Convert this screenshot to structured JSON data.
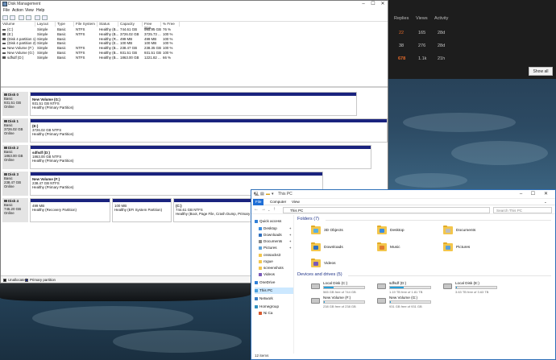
{
  "forum": {
    "headers": [
      "Replies",
      "Views",
      "Activity"
    ],
    "rows": [
      {
        "replies": "22",
        "views": "165",
        "activity": "28d",
        "accent": "#e56b2b"
      },
      {
        "replies": "38",
        "views": "276",
        "activity": "28d",
        "accent": "#c8c8c8"
      },
      {
        "replies": "678",
        "views": "1.1k",
        "activity": "21h",
        "accent": "#e56b2b"
      }
    ],
    "show_all": "Show all"
  },
  "disk_mgmt": {
    "title": "Disk Management",
    "menu": [
      "File",
      "Action",
      "View",
      "Help"
    ],
    "columns": [
      "Volume",
      "Layout",
      "Type",
      "File System",
      "Status",
      "Capacity",
      "Free Spa...",
      "% Free"
    ],
    "volumes": [
      {
        "volume": "(C:)",
        "layout": "Simple",
        "type": "Basic",
        "fs": "NTFS",
        "status": "Healthy (B...",
        "capacity": "744.61 GB",
        "free": "565.95 GB",
        "pct": "76 %"
      },
      {
        "volume": "(E:)",
        "layout": "Simple",
        "type": "Basic",
        "fs": "NTFS",
        "status": "Healthy (B...",
        "capacity": "3726.02 GB",
        "free": "3725.73 ...",
        "pct": "100 %"
      },
      {
        "volume": "(Disk 4 partition 1)",
        "layout": "Simple",
        "type": "Basic",
        "fs": "",
        "status": "Healthy (R...",
        "capacity": "499 MB",
        "free": "499 MB",
        "pct": "100 %"
      },
      {
        "volume": "(Disk 4 partition 2)",
        "layout": "Simple",
        "type": "Basic",
        "fs": "",
        "status": "Healthy (E...",
        "capacity": "100 MB",
        "free": "100 MB",
        "pct": "100 %"
      },
      {
        "volume": "New Volume (F:)",
        "layout": "Simple",
        "type": "Basic",
        "fs": "NTFS",
        "status": "Healthy (B...",
        "capacity": "238.47 GB",
        "free": "238.35 GB",
        "pct": "100 %"
      },
      {
        "volume": "New Volume (G:)",
        "layout": "Simple",
        "type": "Basic",
        "fs": "NTFS",
        "status": "Healthy (B...",
        "capacity": "931.51 GB",
        "free": "931.51 GB",
        "pct": "100 %"
      },
      {
        "volume": "sdfsdf (D:)",
        "layout": "Simple",
        "type": "Basic",
        "fs": "NTFS",
        "status": "Healthy (B...",
        "capacity": "1863.00 GB",
        "free": "1221.82 ...",
        "pct": "66 %"
      }
    ],
    "disks": [
      {
        "name": "Disk 0",
        "type": "Basic",
        "size": "931.51 GB",
        "state": "Online",
        "parts": [
          {
            "name": "New Volume (G:)",
            "size": "931.51 GB NTFS",
            "status": "Healthy (Primary Partition)"
          }
        ]
      },
      {
        "name": "Disk 1",
        "type": "Basic",
        "size": "3726.02 GB",
        "state": "Online",
        "parts": [
          {
            "name": "(E:)",
            "size": "3726.02 GB NTFS",
            "status": "Healthy (Primary Partition)"
          }
        ]
      },
      {
        "name": "Disk 2",
        "type": "Basic",
        "size": "1863.00 GB",
        "state": "Online",
        "parts": [
          {
            "name": "sdfsdf (D:)",
            "size": "1863.00 GB NTFS",
            "status": "Healthy (Primary Partition)"
          }
        ]
      },
      {
        "name": "Disk 3",
        "type": "Basic",
        "size": "238.47 GB",
        "state": "Online",
        "parts": [
          {
            "name": "New Volume (F:)",
            "size": "238.47 GB NTFS",
            "status": "Healthy (Primary Partition)"
          }
        ]
      },
      {
        "name": "Disk 4",
        "type": "Basic",
        "size": "745.20 GB",
        "state": "Online",
        "parts": [
          {
            "name": "",
            "size": "499 MB",
            "status": "Healthy (Recovery Partition)"
          },
          {
            "name": "",
            "size": "100 MB",
            "status": "Healthy (EFI System Partition)"
          },
          {
            "name": "(C:)",
            "size": "744.61 GB NTFS",
            "status": "Healthy (Boot, Page File, Crash Dump, Primary Partition)"
          }
        ]
      }
    ],
    "legend": [
      "Unallocated",
      "Primary partition"
    ],
    "colors": {
      "primary": "#1a237e",
      "unallocated": "#111111"
    }
  },
  "explorer": {
    "title": "This PC",
    "ribbon_tabs": [
      "File",
      "Computer",
      "View"
    ],
    "path": "This PC",
    "search_placeholder": "Search This PC",
    "nav": [
      {
        "label": "Quick access",
        "icon": "star-icon",
        "color": "#2f7fd8",
        "sub": false,
        "pin": false,
        "sel": false
      },
      {
        "label": "Desktop",
        "icon": "desktop-icon",
        "color": "#3a8de0",
        "sub": true,
        "pin": true,
        "sel": false
      },
      {
        "label": "Downloads",
        "icon": "download-icon",
        "color": "#2f6fbf",
        "sub": true,
        "pin": true,
        "sel": false
      },
      {
        "label": "Documents",
        "icon": "documents-icon",
        "color": "#8a8a8a",
        "sub": true,
        "pin": true,
        "sel": false
      },
      {
        "label": "Pictures",
        "icon": "pictures-icon",
        "color": "#5aa0d8",
        "sub": true,
        "pin": true,
        "sel": false
      },
      {
        "label": "csssacks3",
        "icon": "folder-icon",
        "color": "#f3c64c",
        "sub": true,
        "pin": false,
        "sel": false
      },
      {
        "label": "rogue",
        "icon": "folder-icon",
        "color": "#f3c64c",
        "sub": true,
        "pin": false,
        "sel": false
      },
      {
        "label": "screenshots",
        "icon": "folder-icon",
        "color": "#f3c64c",
        "sub": true,
        "pin": false,
        "sel": false
      },
      {
        "label": "Videos",
        "icon": "videos-icon",
        "color": "#7a5ab8",
        "sub": true,
        "pin": false,
        "sel": false
      },
      {
        "label": "OneDrive",
        "icon": "cloud-icon",
        "color": "#2f7fd8",
        "sub": false,
        "pin": false,
        "sel": false
      },
      {
        "label": "This PC",
        "icon": "computer-icon",
        "color": "#4aa0e0",
        "sub": false,
        "pin": false,
        "sel": true
      },
      {
        "label": "Network",
        "icon": "network-icon",
        "color": "#3a7fc8",
        "sub": false,
        "pin": false,
        "sel": false
      },
      {
        "label": "Homegroup",
        "icon": "homegroup-icon",
        "color": "#2f8fbf",
        "sub": false,
        "pin": false,
        "sel": false
      },
      {
        "label": "Ni Ca",
        "icon": "user-icon",
        "color": "#d85a2f",
        "sub": true,
        "pin": false,
        "sel": false
      }
    ],
    "folders_header": "Folders (7)",
    "folders": [
      {
        "name": "3D Objects",
        "inner": "#5ab0e0"
      },
      {
        "name": "Desktop",
        "inner": "#3a8de0"
      },
      {
        "name": "Documents",
        "inner": "#bdbdbd"
      },
      {
        "name": "Downloads",
        "inner": "#2f6fbf"
      },
      {
        "name": "Music",
        "inner": "#e07a2f"
      },
      {
        "name": "Pictures",
        "inner": "#5aa0d8"
      },
      {
        "name": "Videos",
        "inner": "#7a5ab8"
      }
    ],
    "drives_header": "Devices and drives (5)",
    "drives": [
      {
        "name": "Local Disk (C:)",
        "free": "565 GB free of 744 GB",
        "used": 0.24
      },
      {
        "name": "sdfsdf (D:)",
        "free": "1.19 TB free of 1.81 TB",
        "used": 0.34
      },
      {
        "name": "Local Disk (E:)",
        "free": "3.63 TB free of 3.63 TB",
        "used": 0.01
      },
      {
        "name": "New Volume (F:)",
        "free": "238 GB free of 238 GB",
        "used": 0.01
      },
      {
        "name": "New Volume (G:)",
        "free": "931 GB free of 931 GB",
        "used": 0.01
      }
    ],
    "status": "12 items"
  }
}
